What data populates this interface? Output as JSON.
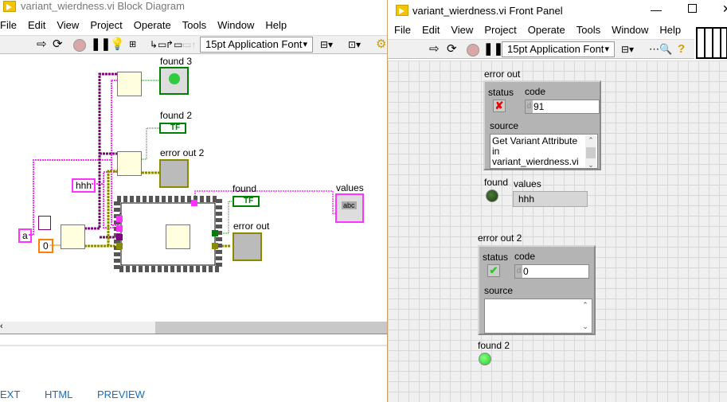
{
  "block_diagram": {
    "title": "variant_wierdness.vi Block Diagram",
    "menu": [
      "File",
      "Edit",
      "View",
      "Project",
      "Operate",
      "Tools",
      "Window",
      "Help"
    ],
    "font_selector": "15pt Application Font",
    "labels": {
      "found3": "found 3",
      "found2": "found 2",
      "error_out2": "error out 2",
      "found": "found",
      "error_out": "error out",
      "values": "values"
    },
    "constants": {
      "name_a": "a",
      "hhh": "hhh",
      "zero": "0"
    },
    "tf": "TF",
    "abc": "abc"
  },
  "bottom_tabs": [
    "EXT",
    "HTML",
    "PREVIEW"
  ],
  "front_panel": {
    "title": "variant_wierdness.vi Front Panel",
    "menu": [
      "File",
      "Edit",
      "View",
      "Project",
      "Operate",
      "Tools",
      "Window",
      "Help"
    ],
    "font_selector": "15pt Application Font",
    "error_out": {
      "label": "error out",
      "status_label": "status",
      "status": "error",
      "code_label": "code",
      "code": "91",
      "source_label": "source",
      "source": "Get Variant Attribute in variant_wierdness.vi"
    },
    "found": {
      "label": "found",
      "value": false
    },
    "values": {
      "label": "values",
      "value": "hhh"
    },
    "error_out2": {
      "label": "error out 2",
      "status_label": "status",
      "status": "ok",
      "code_label": "code",
      "code": "0",
      "source_label": "source",
      "source": ""
    },
    "found2": {
      "label": "found 2",
      "value": true
    },
    "radix": "d"
  },
  "colors": {
    "variant": "#ff33ff",
    "error": "#8a8a00",
    "boolean": "#008000",
    "string": "#ff00ff",
    "cluster": "#800080"
  }
}
